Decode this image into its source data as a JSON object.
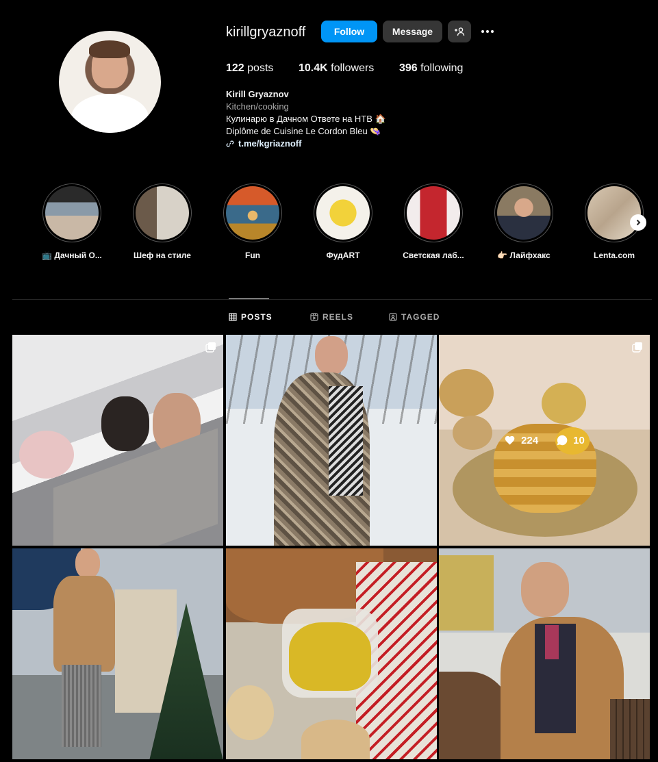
{
  "profile": {
    "username": "kirillgryaznoff",
    "follow_label": "Follow",
    "message_label": "Message",
    "stats": {
      "posts": "122",
      "posts_label": "posts",
      "followers": "10.4K",
      "followers_label": "followers",
      "following": "396",
      "following_label": "following"
    },
    "bio": {
      "name": "Kirill Gryaznov",
      "category": "Kitchen/cooking",
      "line1": "Кулинарю в Дачном Ответе на НТВ 🏠",
      "line2": "Diplôme de Cuisine Le Cordon Bleu 👒",
      "link": "t.me/kgriaznoff"
    }
  },
  "highlights": [
    {
      "label": "📺 Дачный О..."
    },
    {
      "label": "Шеф на стиле"
    },
    {
      "label": "Fun"
    },
    {
      "label": "ФудART"
    },
    {
      "label": "Светская лаб..."
    },
    {
      "label": "👉🏻 Лайфхакс"
    },
    {
      "label": "Lenta.com"
    }
  ],
  "tabs": {
    "posts": "POSTS",
    "reels": "REELS",
    "tagged": "TAGGED"
  },
  "posts": [
    {
      "likes": "",
      "comments": "",
      "badge": "carousel-icon"
    },
    {
      "likes": "",
      "comments": "",
      "badge": ""
    },
    {
      "likes": "224",
      "comments": "10",
      "badge": "carousel-icon"
    },
    {
      "likes": "",
      "comments": "",
      "badge": ""
    },
    {
      "likes": "",
      "comments": "",
      "badge": ""
    },
    {
      "likes": "",
      "comments": "",
      "badge": ""
    }
  ],
  "colors": {
    "accent": "#0095f6",
    "background": "#000000",
    "secondary_button": "#363636"
  }
}
